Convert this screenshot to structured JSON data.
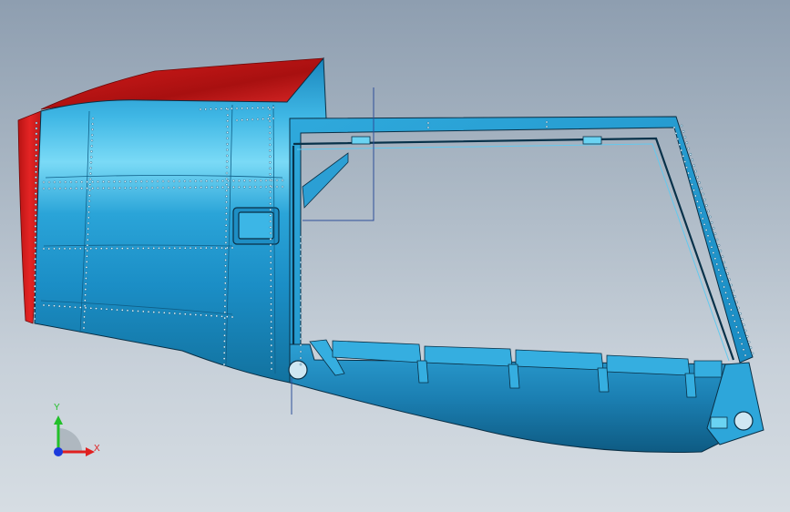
{
  "viewport": {
    "background_top": "#8e9eb0",
    "background_bottom": "#d6dde3"
  },
  "model": {
    "surface_color": "#1f9bd0",
    "highlight_color": "#6fd6f5",
    "shadow_color": "#0d5a80",
    "edge_color": "#0a2f45",
    "cut_face_color": "#e02020",
    "components": [
      "nacelle-skin",
      "upper-red-cut-face",
      "front-red-cut-face",
      "access-panel",
      "side-frame",
      "bottom-flange-ribs",
      "rear-pin-lug"
    ]
  },
  "triad": {
    "y_label": "Y",
    "x_label": "X",
    "y_color": "#22c02a",
    "x_color": "#e02020",
    "z_color": "#1c3adc"
  }
}
